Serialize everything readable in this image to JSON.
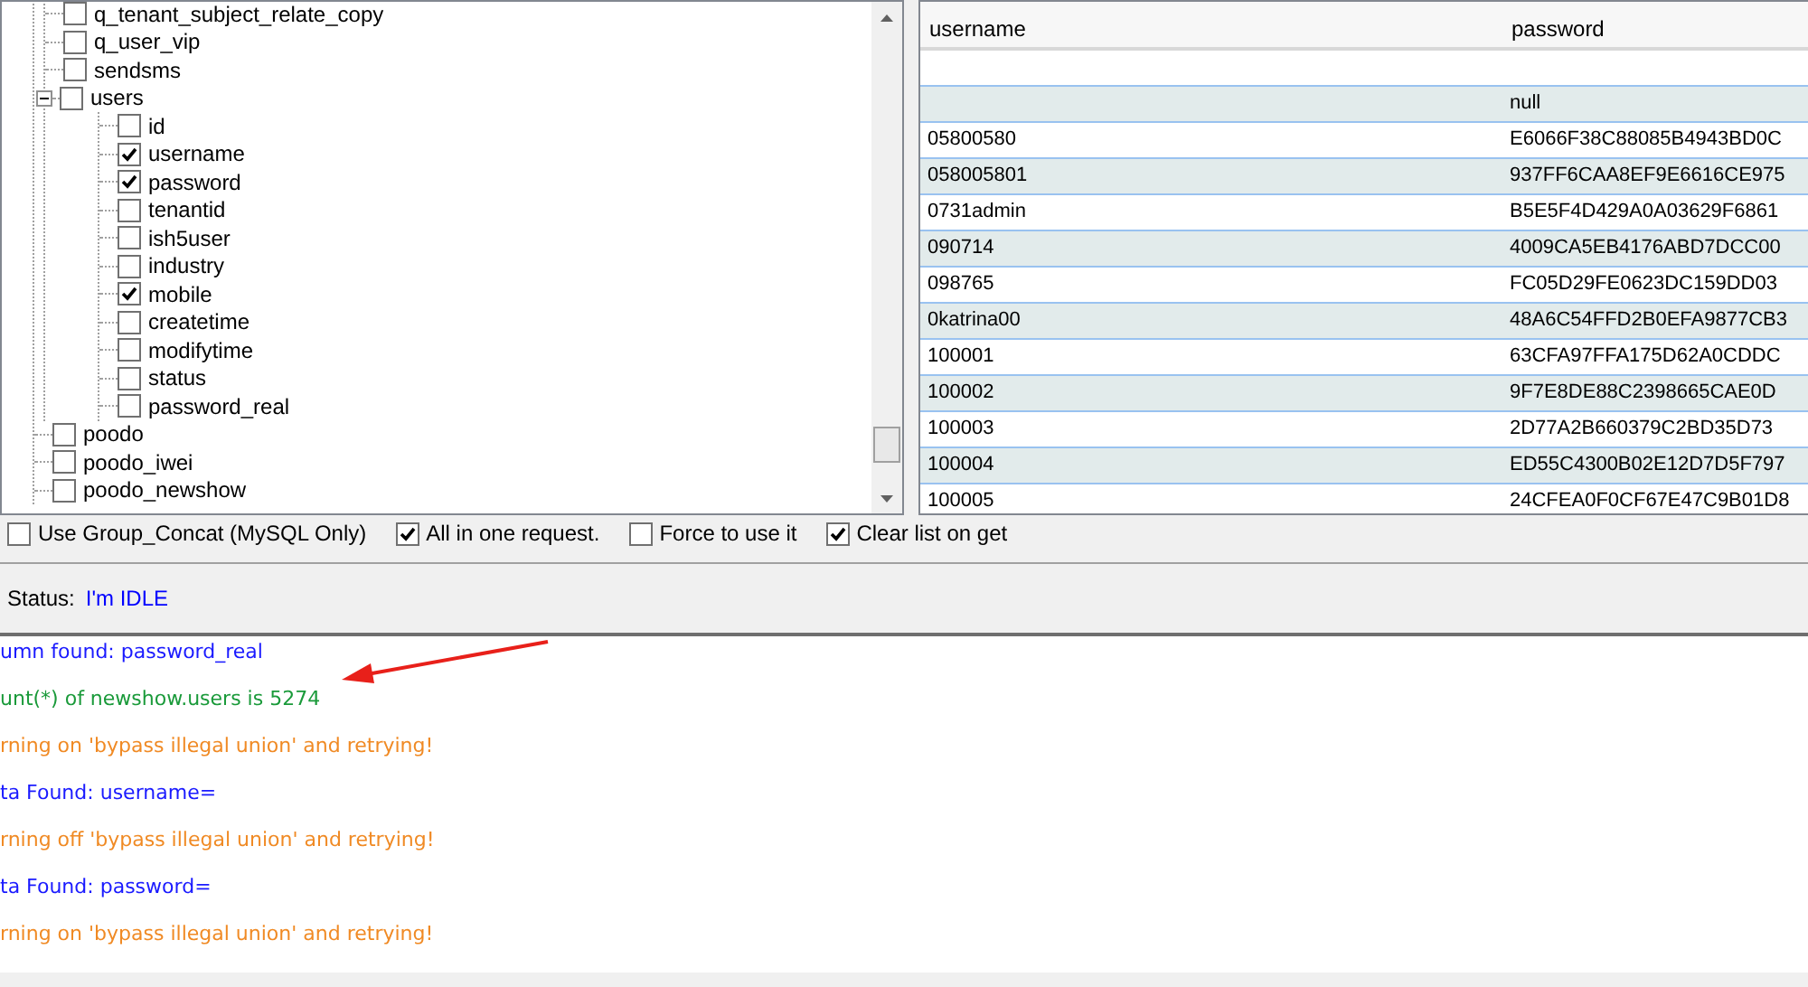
{
  "tree": [
    {
      "children": [
        {
          "label": "q_tenant_subject_relate_copy",
          "checked": false
        },
        {
          "label": "q_user_vip",
          "checked": false
        },
        {
          "label": "sendsms",
          "checked": false
        },
        {
          "label": "users",
          "checked": false,
          "expanded": true,
          "children": [
            {
              "label": "id",
              "checked": false
            },
            {
              "label": "username",
              "checked": true
            },
            {
              "label": "password",
              "checked": true
            },
            {
              "label": "tenantid",
              "checked": false
            },
            {
              "label": "ish5user",
              "checked": false
            },
            {
              "label": "industry",
              "checked": false
            },
            {
              "label": "mobile",
              "checked": true
            },
            {
              "label": "createtime",
              "checked": false
            },
            {
              "label": "modifytime",
              "checked": false
            },
            {
              "label": "status",
              "checked": false
            },
            {
              "label": "password_real",
              "checked": false
            }
          ]
        }
      ]
    },
    {
      "label": "poodo",
      "checked": false
    },
    {
      "label": "poodo_iwei",
      "checked": false
    },
    {
      "label": "poodo_newshow",
      "checked": false
    }
  ],
  "table": {
    "columns": [
      "username",
      "password"
    ],
    "rows": [
      [
        "",
        ""
      ],
      [
        "",
        "null"
      ],
      [
        "05800580",
        "E6066F38C88085B4943BD0C"
      ],
      [
        "058005801",
        "937FF6CAA8EF9E6616CE975"
      ],
      [
        "0731admin",
        "B5E5F4D429A0A03629F6861"
      ],
      [
        "090714",
        "4009CA5EB4176ABD7DCC00"
      ],
      [
        "098765",
        "FC05D29FE0623DC159DD03"
      ],
      [
        "0katrina00",
        "48A6C54FFD2B0EFA9877CB3"
      ],
      [
        "100001",
        "63CFA97FFA175D62A0CDDC"
      ],
      [
        "100002",
        "9F7E8DE88C2398665CAE0D"
      ],
      [
        "100003",
        "2D77A2B660379C2BD35D73"
      ],
      [
        "100004",
        "ED55C4300B02E12D7D5F797"
      ],
      [
        "100005",
        "24CFEA0F0CF67E47C9B01D8"
      ]
    ]
  },
  "options": [
    {
      "label": "Use Group_Concat (MySQL Only)",
      "checked": false
    },
    {
      "label": "All in one request.",
      "checked": true
    },
    {
      "label": "Force to use it",
      "checked": false
    },
    {
      "label": "Clear list on get",
      "checked": true
    }
  ],
  "status": {
    "label": "Status:",
    "value": "I'm IDLE"
  },
  "log": [
    {
      "kind": "info",
      "text": "umn found: password_real"
    },
    {
      "kind": "success",
      "text": "unt(*) of newshow.users is 5274"
    },
    {
      "kind": "warning",
      "text": "rning on 'bypass illegal union' and retrying!"
    },
    {
      "kind": "info",
      "text": "ta Found: username="
    },
    {
      "kind": "warning",
      "text": "rning off 'bypass illegal union' and retrying!"
    },
    {
      "kind": "info",
      "text": "ta Found: password="
    },
    {
      "kind": "warning",
      "text": "rning on 'bypass illegal union' and retrying!"
    }
  ]
}
